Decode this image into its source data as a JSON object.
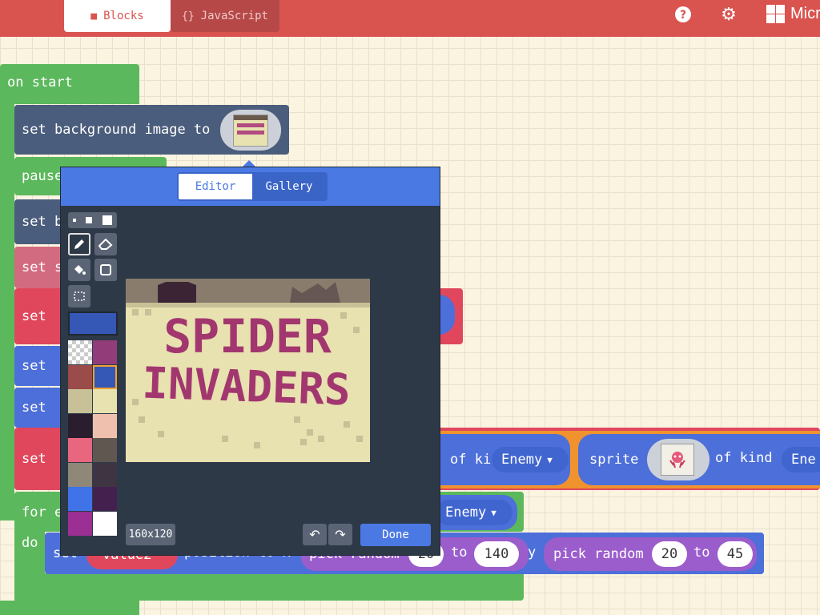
{
  "header": {
    "tabs": [
      {
        "label": "Blocks",
        "icon": "puzzle-icon"
      },
      {
        "label": "JavaScript",
        "icon": "braces-icon"
      }
    ],
    "braces_text": "{}",
    "help_icon": "question-icon",
    "settings_icon": "gear-icon",
    "brand": "Micr",
    "colors": {
      "header": "#d9534f",
      "green": "#5cb85c",
      "blue": "#4d6fd9",
      "red": "#e0475d",
      "slate": "#4b5d7c"
    }
  },
  "blocks": {
    "on_start": "on start",
    "set_background": "set background image to",
    "pause": "pause",
    "set_b": "set b",
    "set_s": "set s",
    "set": "set",
    "of_kind": "of kind",
    "enemy": "Enemy",
    "sprite": "sprite",
    "of_kind2": "of kind",
    "enemy2": "Ene",
    "for_e": "for e",
    "do": "do",
    "enemy3": "Enemy",
    "set_value_prefix": "set",
    "value_var": "value2",
    "position_to_x": "position to x",
    "pick_random": "pick random",
    "num_20": "20",
    "to": "to",
    "num_140": "140",
    "y": "y",
    "pick_random2": "pick random",
    "num_20b": "20",
    "to2": "to",
    "num_45": "45"
  },
  "editor": {
    "tabs": [
      "Editor",
      "Gallery"
    ],
    "size_label": "160x120",
    "done_label": "Done",
    "tools": [
      "pencil-icon",
      "eraser-icon",
      "fill-icon",
      "rectangle-icon",
      "marquee-icon"
    ],
    "selected_color": "#3557b5",
    "palette": [
      "transparent",
      "#923d79",
      "#9b4b49",
      "#3557b5",
      "#c8c096",
      "#e8e1b0",
      "#2a1e2e",
      "#f0c0ae",
      "#e8677f",
      "#605850",
      "#8f8878",
      "#3e3442",
      "#4072e8",
      "#44204f",
      "#9b2f94",
      "#ffffff"
    ],
    "image_title": "SPIDER INVADERS"
  }
}
